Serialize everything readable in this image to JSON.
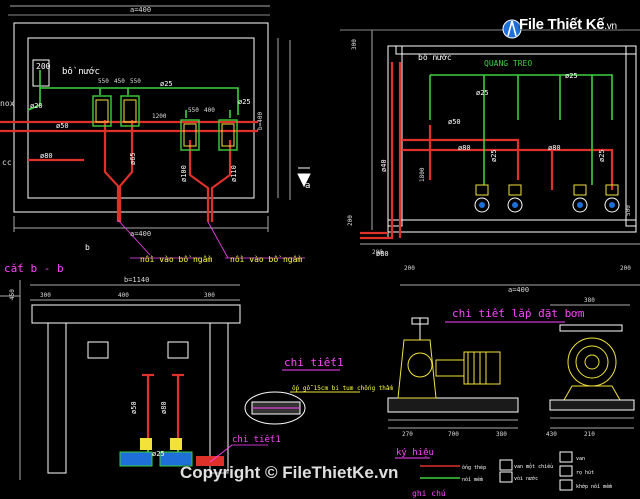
{
  "colors": {
    "background": "#000000",
    "wall": "#ffffff",
    "red_pipe": "#e0302a",
    "green_pipe": "#3dd13d",
    "label_white": "#ffffff",
    "label_magenta": "#ff44ff",
    "label_yellow": "#ffff40",
    "pump_yellow": "#f2e23a",
    "dimension": "#dddddd",
    "watermark_blue": "#1e6fd8"
  },
  "logo": {
    "brand_main": "File Thiết Kế",
    "brand_suffix": ".vn",
    "icon": "drafting-tool-icon"
  },
  "watermark": {
    "text": "Copyright © FileThietKe.vn"
  },
  "plan_view": {
    "top_dimension": "a=400",
    "tank_label": "bồ nước",
    "tank_level": "200",
    "pipe_labels": [
      "ø25",
      "ø25",
      "ø20",
      "ø50",
      "ø80",
      "ø65",
      "ø100",
      "ø110"
    ],
    "dim_labels": [
      "550",
      "450",
      "550",
      "400",
      "550",
      "1200",
      "b=400"
    ],
    "inlet_label_1": "nồi vào bồ ngầm",
    "inlet_label_2": "nồi vào bồ ngầm",
    "bottom_dim": "a=400",
    "section_mark": "a",
    "section_mark_b": "b",
    "left_text_1": "nox",
    "left_text_2": "cc"
  },
  "section_a": {
    "hanger_label": "QUANG TREO",
    "tank_label": "bồ nước",
    "pipe_labels": [
      "ø25",
      "ø25",
      "ø50",
      "ø80",
      "ø25",
      "ø25",
      "ø40",
      "ø80"
    ],
    "dim_labels": [
      "1800",
      "200",
      "300",
      "200",
      "200",
      "a=400",
      "200",
      "500"
    ],
    "bottom_pipe": "ø80"
  },
  "section_b": {
    "title": "cắt b - b",
    "top_dim": "b=1140",
    "dims": [
      "300",
      "400",
      "300",
      "450"
    ],
    "pipe_labels": [
      "ø50",
      "ø80",
      "ø25"
    ]
  },
  "detail_1": {
    "title": "chi tiết1",
    "note": "ốp gỗ 15cm bi tum chống thấm",
    "callout": "chi tiết1"
  },
  "pump_detail": {
    "title": "chi tiết lắp đặt bơm",
    "dims": [
      "270",
      "700",
      "380",
      "380",
      "210",
      "430"
    ]
  },
  "legend": {
    "title": "ký hiệu",
    "items": [
      {
        "symbol": "ống thép",
        "desc": "van một chiều"
      },
      {
        "symbol": "nối mềm",
        "desc": "vòi nước"
      },
      {
        "symbol": "",
        "desc": "van"
      },
      {
        "symbol": "",
        "desc": "rọ hút"
      },
      {
        "symbol": "",
        "desc": "khớp nối mềm"
      }
    ],
    "note_title": "ghi chú"
  }
}
